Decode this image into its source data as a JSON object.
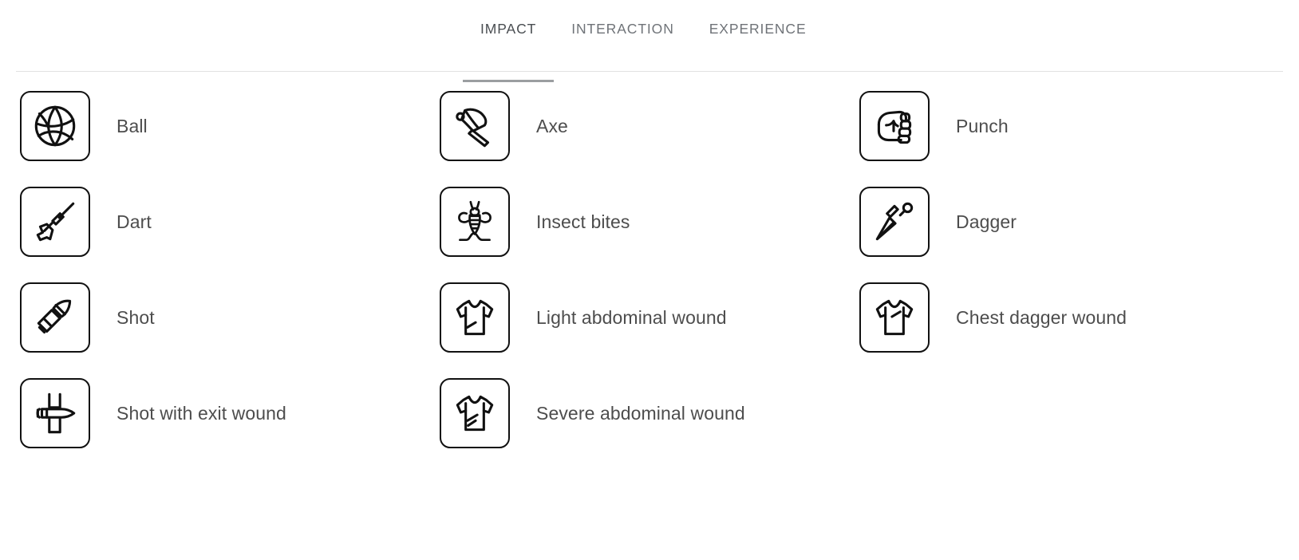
{
  "tabs": [
    {
      "label": "IMPACT",
      "active": true
    },
    {
      "label": "INTERACTION",
      "active": false
    },
    {
      "label": "EXPERIENCE",
      "active": false
    }
  ],
  "colors": {
    "tab_inactive": "#6f7378",
    "tab_active": "#4a4e52",
    "tab_underline": "#9b9ea1",
    "divider": "#e2e2e2",
    "icon_stroke": "#111111",
    "label_text": "#4d4d4d",
    "background": "#ffffff"
  },
  "items": [
    {
      "label": "Ball",
      "icon": "basketball-icon"
    },
    {
      "label": "Axe",
      "icon": "axe-icon"
    },
    {
      "label": "Punch",
      "icon": "fist-icon"
    },
    {
      "label": "Dart",
      "icon": "dart-icon"
    },
    {
      "label": "Insect bites",
      "icon": "bee-icon"
    },
    {
      "label": "Dagger",
      "icon": "dagger-icon"
    },
    {
      "label": "Shot",
      "icon": "bullet-icon"
    },
    {
      "label": "Light abdominal wound",
      "icon": "tshirt-single-slash-icon"
    },
    {
      "label": "Chest dagger wound",
      "icon": "tshirt-chest-slash-icon"
    },
    {
      "label": "Shot with exit wound",
      "icon": "bullet-through-body-icon"
    },
    {
      "label": "Severe abdominal wound",
      "icon": "tshirt-double-slash-icon"
    }
  ]
}
